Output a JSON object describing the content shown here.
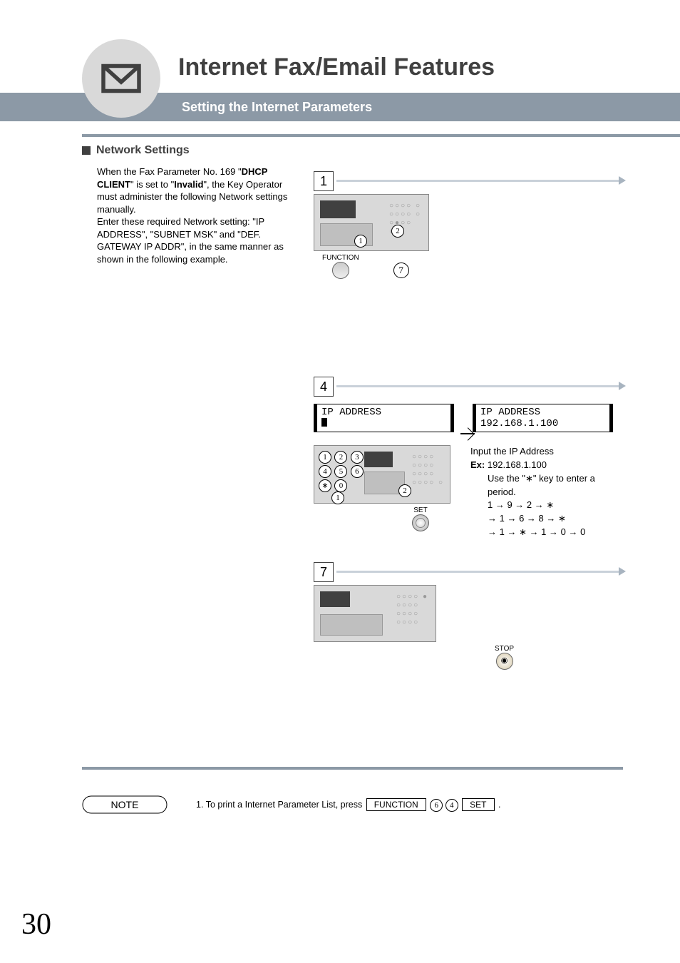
{
  "header": {
    "title": "Internet Fax/Email Features",
    "subtitle": "Setting the Internet Parameters"
  },
  "section": {
    "title": "Network Settings",
    "p1a": "When the Fax Parameter No. 169 \"",
    "p1b": "DHCP CLIENT",
    "p1c": "\" is set to \"",
    "p1d": "Invalid",
    "p1e": "\", the Key Operator must administer the following Network settings manually.",
    "p2": "Enter these required Network setting: \"IP ADDRESS\", \"SUBNET MSK\" and \"DEF. GATEWAY IP ADDR\", in the same manner as shown in the following example."
  },
  "steps": {
    "s1": "1",
    "s4": "4",
    "s7": "7"
  },
  "labels": {
    "function": "FUNCTION",
    "set": "SET",
    "stop": "STOP"
  },
  "lcd": {
    "l4a_line1": "IP ADDRESS",
    "l4b_line1": "IP ADDRESS",
    "l4b_line2": "192.168.1.100"
  },
  "inst": {
    "t1": "Input the IP Address",
    "t2a": "Ex:",
    "t2b": " 192.168.1.100",
    "t3": "Use the \"∗\" key to enter a period.",
    "seq1": "1 → 9 → 2 → ∗",
    "seq2": "→ 1 → 6 → 8 → ∗",
    "seq3": "→ 1 → ∗ → 1 → 0 → 0"
  },
  "note": {
    "label": "NOTE",
    "n1": "1.",
    "text_a": "To print a Internet Parameter List, press ",
    "key_func": "FUNCTION",
    "c6": "6",
    "c4": "4",
    "key_set": "SET",
    "period": "."
  },
  "page": "30"
}
